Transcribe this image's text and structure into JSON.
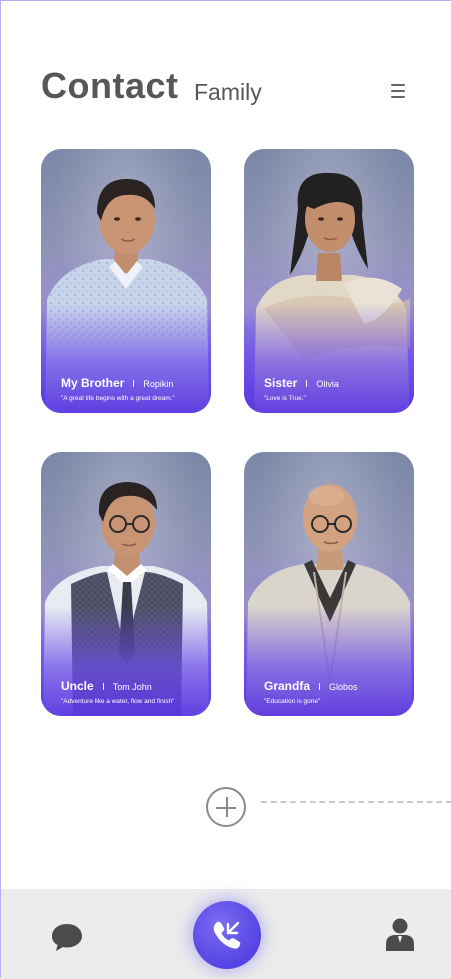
{
  "header": {
    "title": "Contact",
    "subtitle": "Family"
  },
  "cards": [
    {
      "name": "My Brother",
      "nickname": "Ropikin",
      "quote": "\"A great life begins with a great dream.\""
    },
    {
      "name": "Sister",
      "nickname": "Olivia",
      "quote": "\"Love is True.\""
    },
    {
      "name": "Uncle",
      "nickname": "Tom John",
      "quote": "\"Adventure like a water, flow and finish\""
    },
    {
      "name": "Grandfa",
      "nickname": "Globos",
      "quote": "\"Education is gone\""
    }
  ],
  "icons": {
    "menu": "menu-icon",
    "add": "add-icon",
    "chat": "chat-icon",
    "call": "phone-icon",
    "profile": "person-icon"
  },
  "colors": {
    "accent": "#5544e3",
    "title": "#575757",
    "bar": "#ececec"
  }
}
